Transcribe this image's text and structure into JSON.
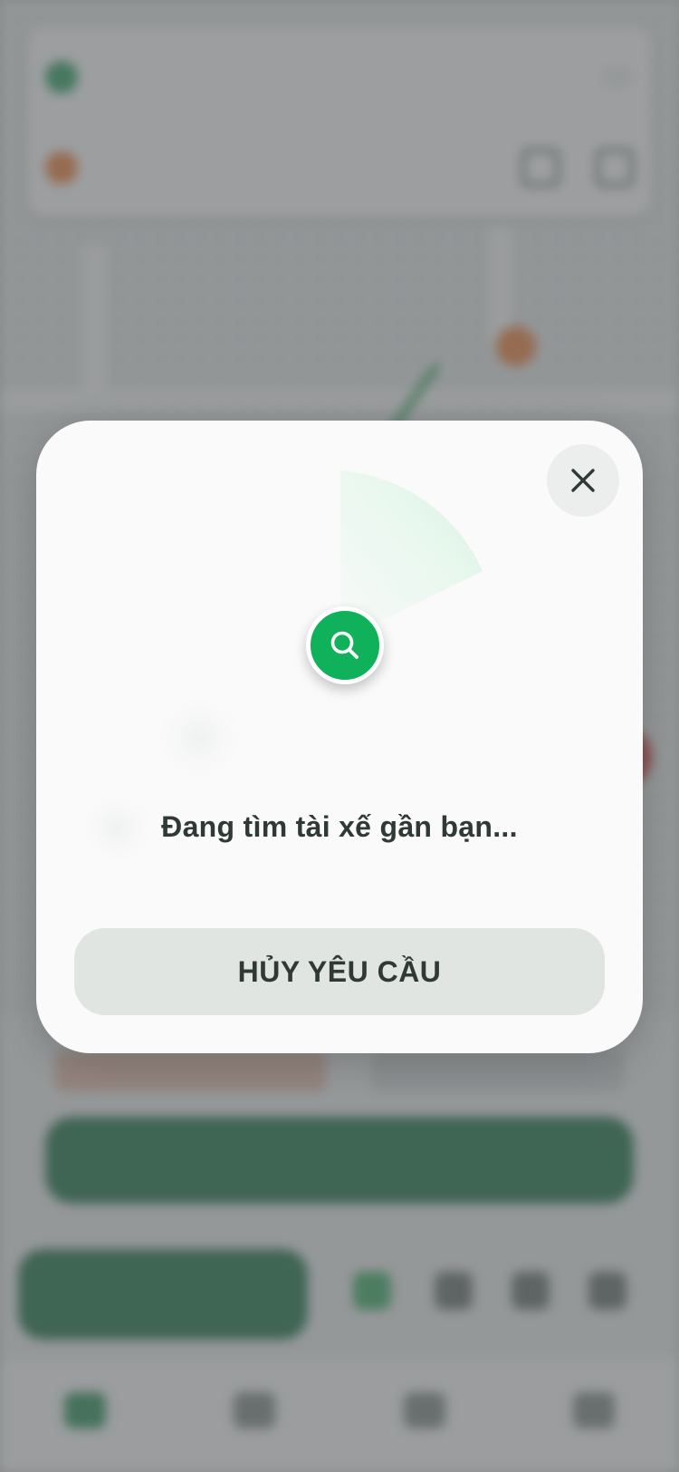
{
  "modal": {
    "status_text": "Đang tìm tài xế gần bạn...",
    "cancel_label": "HỦY YÊU CẦU",
    "close_icon": "close-icon",
    "search_icon": "search-icon",
    "accent_color": "#0fb25a"
  }
}
